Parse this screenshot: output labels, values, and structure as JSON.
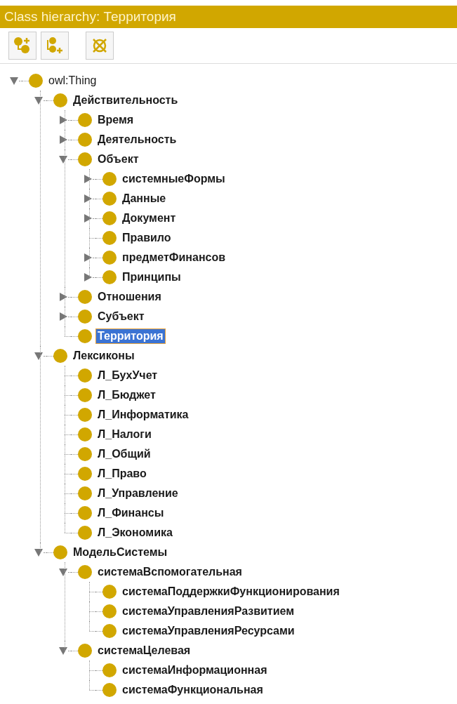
{
  "window": {
    "title": "Class hierarchy: Территория"
  },
  "tree": [
    {
      "label": "owl:Thing",
      "bold": false,
      "selected": false,
      "expanded": true,
      "children": [
        {
          "label": "Действительность",
          "bold": true,
          "selected": false,
          "expanded": true,
          "children": [
            {
              "label": "Время",
              "bold": true,
              "selected": false,
              "expanded": false
            },
            {
              "label": "Деятельность",
              "bold": true,
              "selected": false,
              "expanded": false
            },
            {
              "label": "Объект",
              "bold": true,
              "selected": false,
              "expanded": true,
              "children": [
                {
                  "label": "системныеФормы",
                  "bold": true,
                  "selected": false,
                  "expanded": false
                },
                {
                  "label": "Данные",
                  "bold": true,
                  "selected": false,
                  "expanded": false
                },
                {
                  "label": "Документ",
                  "bold": true,
                  "selected": false,
                  "expanded": false
                },
                {
                  "label": "Правило",
                  "bold": true,
                  "selected": false
                },
                {
                  "label": "предметФинансов",
                  "bold": true,
                  "selected": false,
                  "expanded": false
                },
                {
                  "label": "Принципы",
                  "bold": true,
                  "selected": false,
                  "expanded": false
                }
              ]
            },
            {
              "label": "Отношения",
              "bold": true,
              "selected": false,
              "expanded": false
            },
            {
              "label": "Субъект",
              "bold": true,
              "selected": false,
              "expanded": false
            },
            {
              "label": "Территория",
              "bold": true,
              "selected": true
            }
          ]
        },
        {
          "label": "Лексиконы",
          "bold": true,
          "selected": false,
          "expanded": true,
          "children": [
            {
              "label": "Л_БухУчет",
              "bold": true,
              "selected": false
            },
            {
              "label": "Л_Бюджет",
              "bold": true,
              "selected": false
            },
            {
              "label": "Л_Информатика",
              "bold": true,
              "selected": false
            },
            {
              "label": "Л_Налоги",
              "bold": true,
              "selected": false
            },
            {
              "label": "Л_Общий",
              "bold": true,
              "selected": false
            },
            {
              "label": "Л_Право",
              "bold": true,
              "selected": false
            },
            {
              "label": "Л_Управление",
              "bold": true,
              "selected": false
            },
            {
              "label": "Л_Финансы",
              "bold": true,
              "selected": false
            },
            {
              "label": "Л_Экономика",
              "bold": true,
              "selected": false
            }
          ]
        },
        {
          "label": "МодельСистемы",
          "bold": true,
          "selected": false,
          "expanded": true,
          "children": [
            {
              "label": "системаВспомогательная",
              "bold": true,
              "selected": false,
              "expanded": true,
              "children": [
                {
                  "label": "системаПоддержкиФункционирования",
                  "bold": true,
                  "selected": false
                },
                {
                  "label": "системаУправленияРазвитием",
                  "bold": true,
                  "selected": false
                },
                {
                  "label": "системаУправленияРесурсами",
                  "bold": true,
                  "selected": false
                }
              ]
            },
            {
              "label": "системаЦелевая",
              "bold": true,
              "selected": false,
              "expanded": true,
              "children": [
                {
                  "label": "системаИнформационная",
                  "bold": true,
                  "selected": false
                },
                {
                  "label": "системаФункциональная",
                  "bold": true,
                  "selected": false
                }
              ]
            }
          ]
        }
      ]
    }
  ]
}
